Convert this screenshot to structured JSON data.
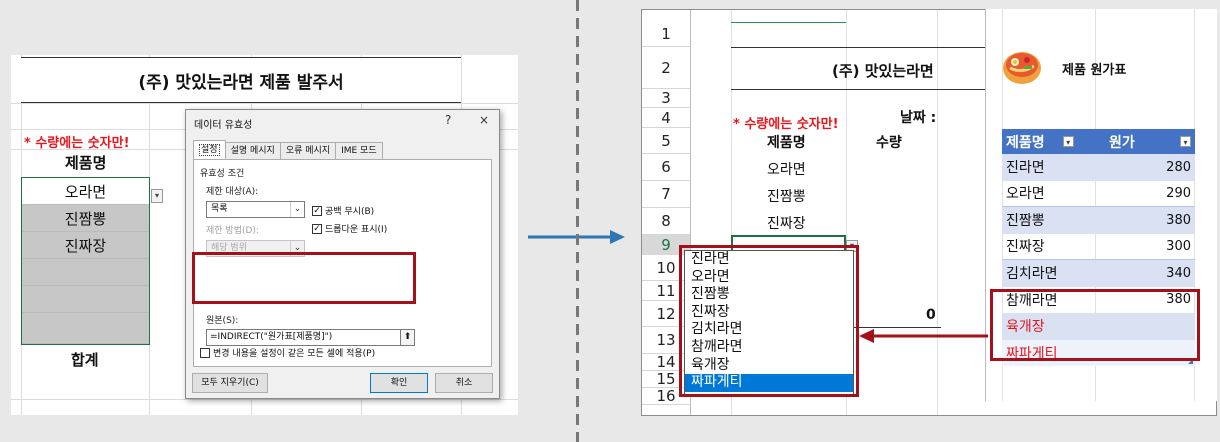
{
  "left": {
    "title": "(주) 맛있는라면 제품 발주서",
    "note": "* 수량에는 숫자만!",
    "col_header": "제품명",
    "items": [
      "오라면",
      "진짬뽕",
      "진짜장",
      "",
      "",
      ""
    ],
    "total_label": "합계"
  },
  "dialog": {
    "title": "데이터 유효성",
    "help": "?",
    "close": "×",
    "tabs": [
      "설정",
      "설명 메시지",
      "오류 메시지",
      "IME 모드"
    ],
    "section": "유효성 조건",
    "allow_label": "제한 대상(A):",
    "allow_value": "목록",
    "ignore_blank": "공백 무시(B)",
    "method_label": "제한 방법(D):",
    "method_value": "해당 범위",
    "in_cell_dropdown": "드롭다운 표시(I)",
    "source_label": "원본(S):",
    "source_value": "=INDIRECT(\"원가표[제품명]\")",
    "apply_all": "변경 내용을 설정이 같은 모든 셀에 적용(P)",
    "clear_all": "모두 지우기(C)",
    "ok": "확인",
    "cancel": "취소"
  },
  "right": {
    "title": "(주) 맛있는라면",
    "date_label": "날짜 :",
    "note": "* 수량에는 숫자만!",
    "col_name": "제품명",
    "col_qty": "수량",
    "items": [
      "오라면",
      "진짬뽕",
      "진짜장"
    ],
    "row_numbers": [
      "1",
      "2",
      "3",
      "4",
      "5",
      "6",
      "7",
      "8",
      "9",
      "10",
      "11",
      "12",
      "13",
      "14",
      "15",
      "16"
    ],
    "total_value": "0",
    "dropdown": [
      "진라면",
      "오라면",
      "진짬뽕",
      "진짜장",
      "김치라면",
      "참깨라면",
      "육개장",
      "짜파게티"
    ],
    "dropdown_selected": "짜파게티"
  },
  "cost": {
    "title": "제품 원가표",
    "headers": [
      "제품명",
      "원가"
    ],
    "rows": [
      {
        "name": "진라면",
        "price": "280"
      },
      {
        "name": "오라면",
        "price": "290"
      },
      {
        "name": "진짬뽕",
        "price": "380"
      },
      {
        "name": "진짜장",
        "price": "300"
      },
      {
        "name": "김치라면",
        "price": "340"
      },
      {
        "name": "참깨라면",
        "price": "380"
      },
      {
        "name": "육개장",
        "price": ""
      },
      {
        "name": "짜파게티",
        "price": ""
      }
    ]
  },
  "colors": {
    "accent_red": "#a5111b",
    "note_red": "#e8161b",
    "table_header": "#4472c4",
    "table_band": "#d9e1f2",
    "selection_blue": "#0078d7",
    "arrow_blue": "#2e75b6"
  }
}
